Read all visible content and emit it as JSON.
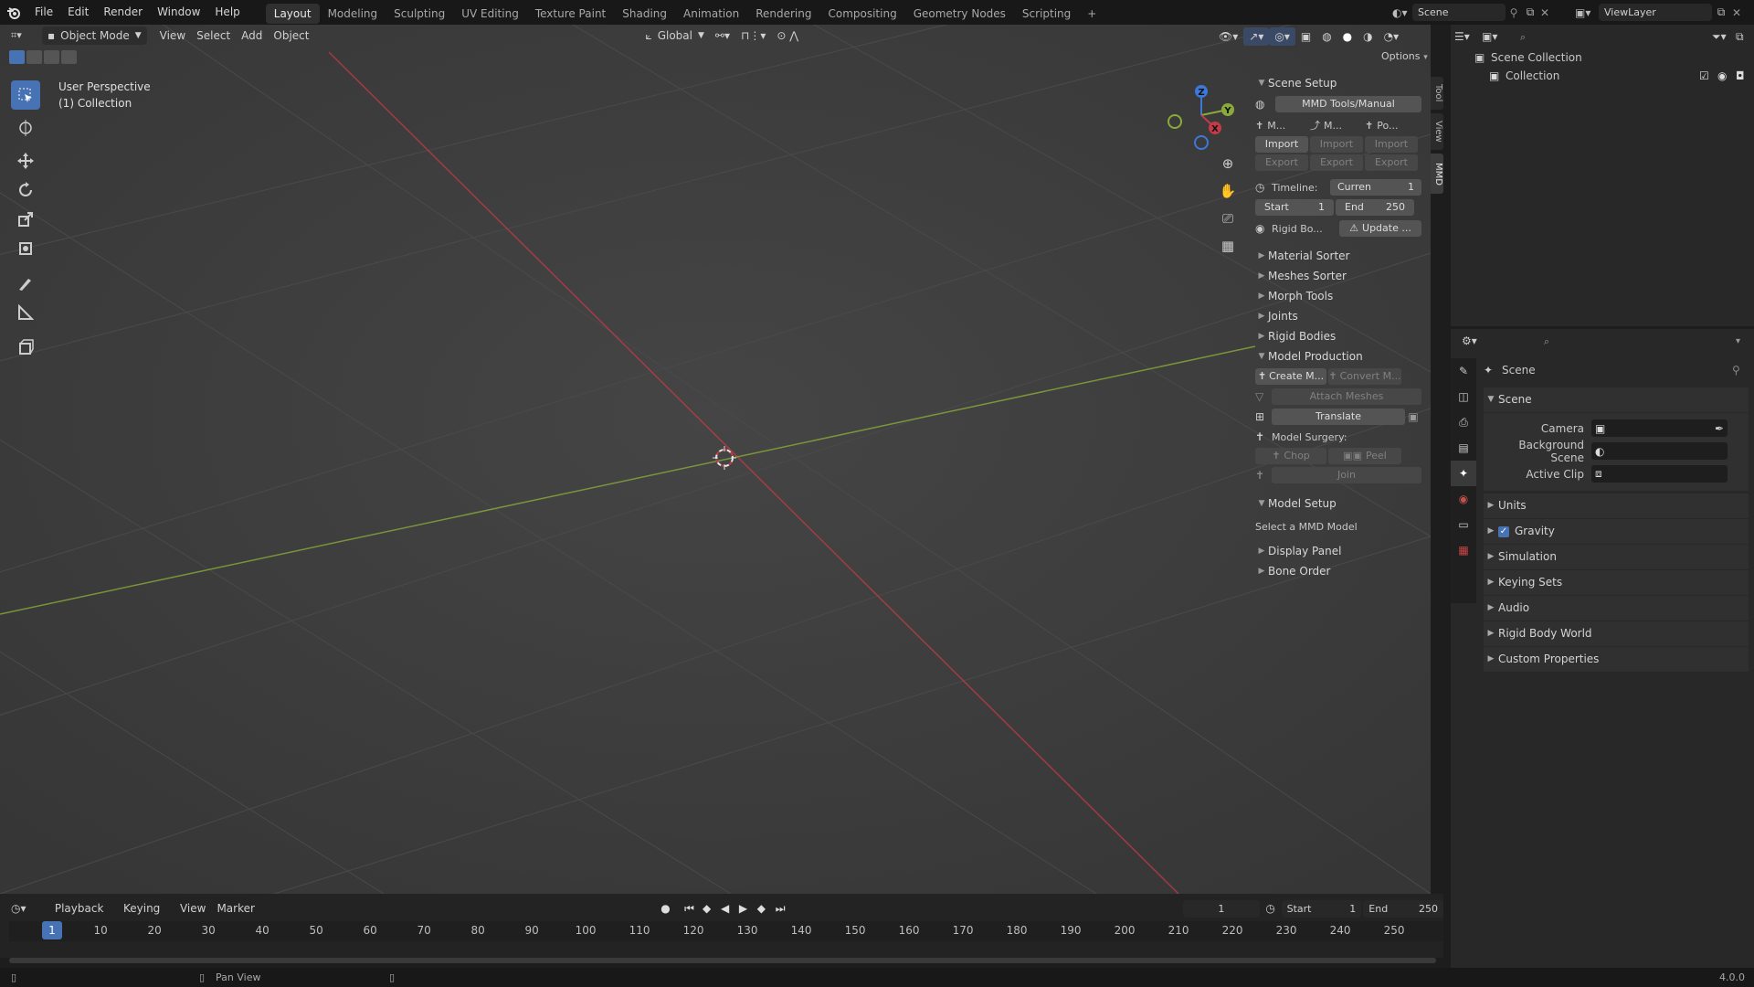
{
  "menubar": {
    "items": [
      "File",
      "Edit",
      "Render",
      "Window",
      "Help"
    ],
    "workspaces": [
      "Layout",
      "Modeling",
      "Sculpting",
      "UV Editing",
      "Texture Paint",
      "Shading",
      "Animation",
      "Rendering",
      "Compositing",
      "Geometry Nodes",
      "Scripting"
    ],
    "active_workspace": "Layout",
    "add_tab": "+",
    "scene_name": "Scene",
    "view_layer": "ViewLayer"
  },
  "viewport_header": {
    "mode": "Object Mode",
    "menus": [
      "View",
      "Select",
      "Add",
      "Object"
    ],
    "transform_orientation": "Global",
    "options": "Options"
  },
  "viewport": {
    "perspective_label": "User Perspective",
    "collection_label": "(1) Collection",
    "gizmo_axes": [
      "Z",
      "Y",
      "X"
    ]
  },
  "side_tabs": [
    "Tool",
    "View",
    "MMD"
  ],
  "npanel": {
    "scene_setup": "Scene Setup",
    "manual_button": "MMD Tools/Manual",
    "import_cols": [
      {
        "label": "M...",
        "import": "Import",
        "export": "Export"
      },
      {
        "label": "M...",
        "import": "Import",
        "export": "Export"
      },
      {
        "label": "Po...",
        "import": "Import",
        "export": "Export"
      }
    ],
    "timeline_label": "Timeline:",
    "current_label": "Curren",
    "current_value": "1",
    "start_label": "Start",
    "start_value": "1",
    "end_label": "End",
    "end_value": "250",
    "rigid_label": "Rigid Bo...",
    "update_button": "Update ...",
    "collapsed_sections": [
      "Material Sorter",
      "Meshes Sorter",
      "Morph Tools",
      "Joints",
      "Rigid Bodies"
    ],
    "model_production": "Model Production",
    "create_button": "Create M...",
    "convert_button": "Convert M...",
    "attach_button": "Attach Meshes",
    "translate_button": "Translate",
    "model_surgery": "Model Surgery:",
    "chop": "Chop",
    "peel": "Peel",
    "join": "Join",
    "model_setup": "Model Setup",
    "select_hint": "Select a MMD Model",
    "tail_sections": [
      "Display Panel",
      "Bone Order"
    ]
  },
  "outliner": {
    "root": "Scene Collection",
    "child": "Collection"
  },
  "properties": {
    "context": "Scene",
    "section_scene": "Scene",
    "camera_label": "Camera",
    "background_label": "Background Scene",
    "clip_label": "Active Clip",
    "sections": [
      "Units",
      "Gravity",
      "Simulation",
      "Keying Sets",
      "Audio",
      "Rigid Body World",
      "Custom Properties"
    ]
  },
  "timeline": {
    "menus": [
      "Playback",
      "Keying",
      "View",
      "Marker"
    ],
    "current_frame": "1",
    "start_label": "Start",
    "start_value": "1",
    "end_label": "End",
    "end_value": "250",
    "ticks": [
      "1",
      "10",
      "20",
      "30",
      "40",
      "50",
      "60",
      "70",
      "80",
      "90",
      "100",
      "110",
      "120",
      "130",
      "140",
      "150",
      "160",
      "170",
      "180",
      "190",
      "200",
      "210",
      "220",
      "230",
      "240",
      "250"
    ]
  },
  "statusbar": {
    "pan_view": "Pan View",
    "version": "4.0.0"
  },
  "colors": {
    "accent": "#4772b3",
    "x_axis": "#c43b48",
    "y_axis": "#8aaa3a",
    "z_axis": "#3c78d8"
  }
}
